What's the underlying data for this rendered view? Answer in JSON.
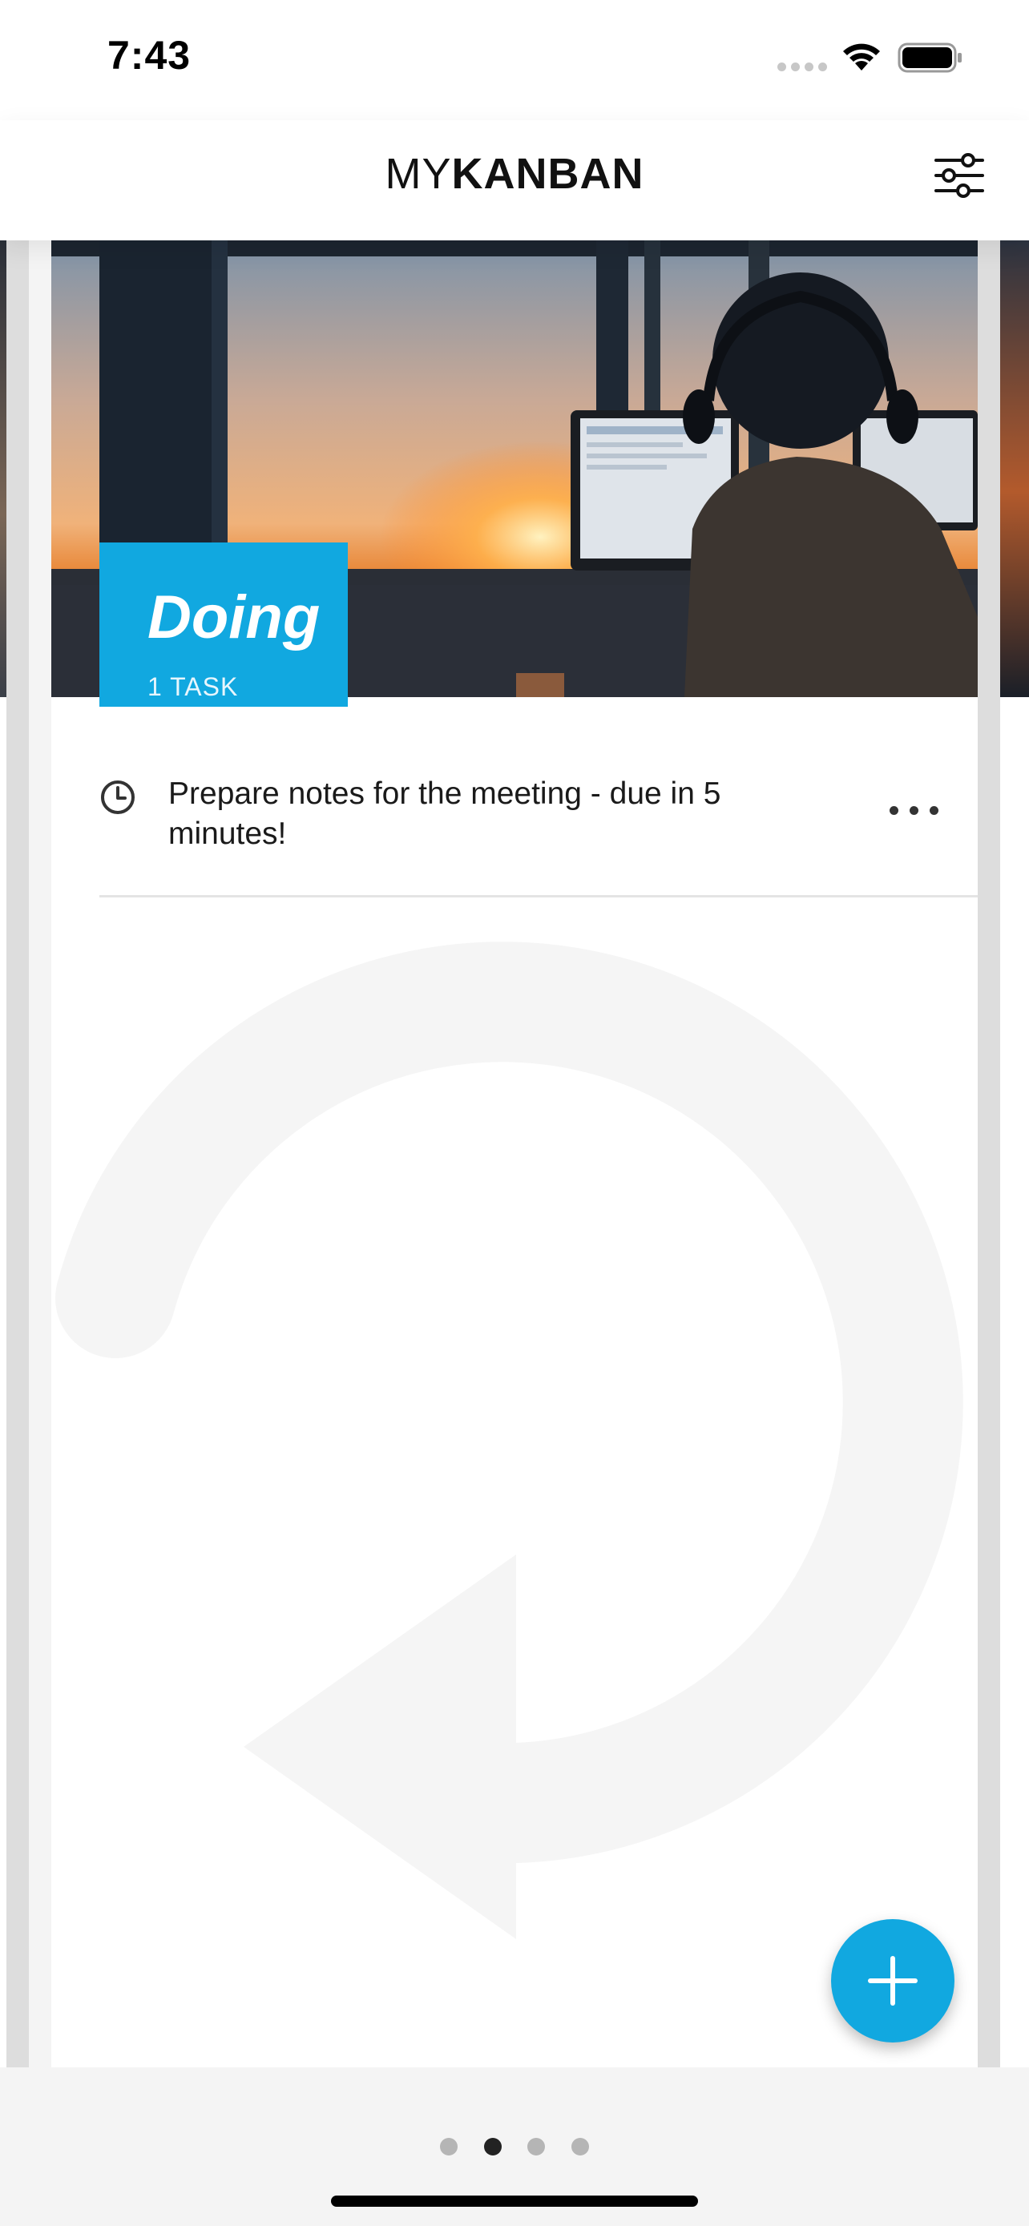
{
  "status_bar": {
    "time": "7:43"
  },
  "header": {
    "title_light": "MY",
    "title_bold": "KANBAN",
    "settings_icon": "sliders-icon"
  },
  "column": {
    "title": "Doing",
    "task_count": "1 TASK",
    "accent_color": "#11a8e0"
  },
  "tasks": [
    {
      "icon": "clock-icon",
      "text": "Prepare notes for the meeting - due in 5 minutes!",
      "menu_icon": "more-horizontal-icon"
    }
  ],
  "fab": {
    "icon": "plus-icon"
  },
  "pagination": {
    "total_pages": 4,
    "current_page": 2
  }
}
